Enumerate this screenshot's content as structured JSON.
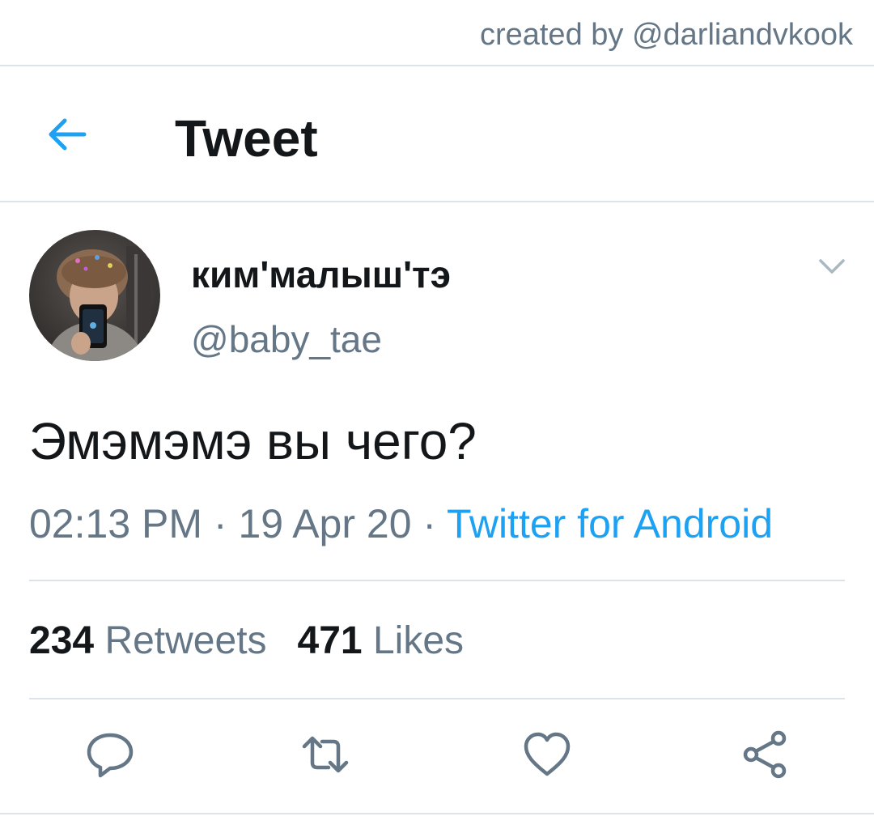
{
  "credit": "created by @darliandvkook",
  "header": {
    "title": "Tweet"
  },
  "tweet": {
    "display_name": "ким'малыш'тэ",
    "handle": "@baby_tae",
    "text": "Эмэмэмэ вы чего?",
    "time": "02:13 PM",
    "date": "19 Apr 20",
    "separator": " · ",
    "source": "Twitter for Android"
  },
  "stats": {
    "retweets_count": "234",
    "retweets_label": "Retweets",
    "likes_count": "471",
    "likes_label": "Likes"
  },
  "icons": {
    "back": "arrow-left-icon",
    "more": "chevron-down-icon",
    "reply": "reply-icon",
    "retweet": "retweet-icon",
    "like": "heart-icon",
    "share": "share-icon"
  },
  "colors": {
    "accent": "#1da1f2",
    "text": "#14171a",
    "secondary": "#657786",
    "divider": "#dde3e8"
  }
}
